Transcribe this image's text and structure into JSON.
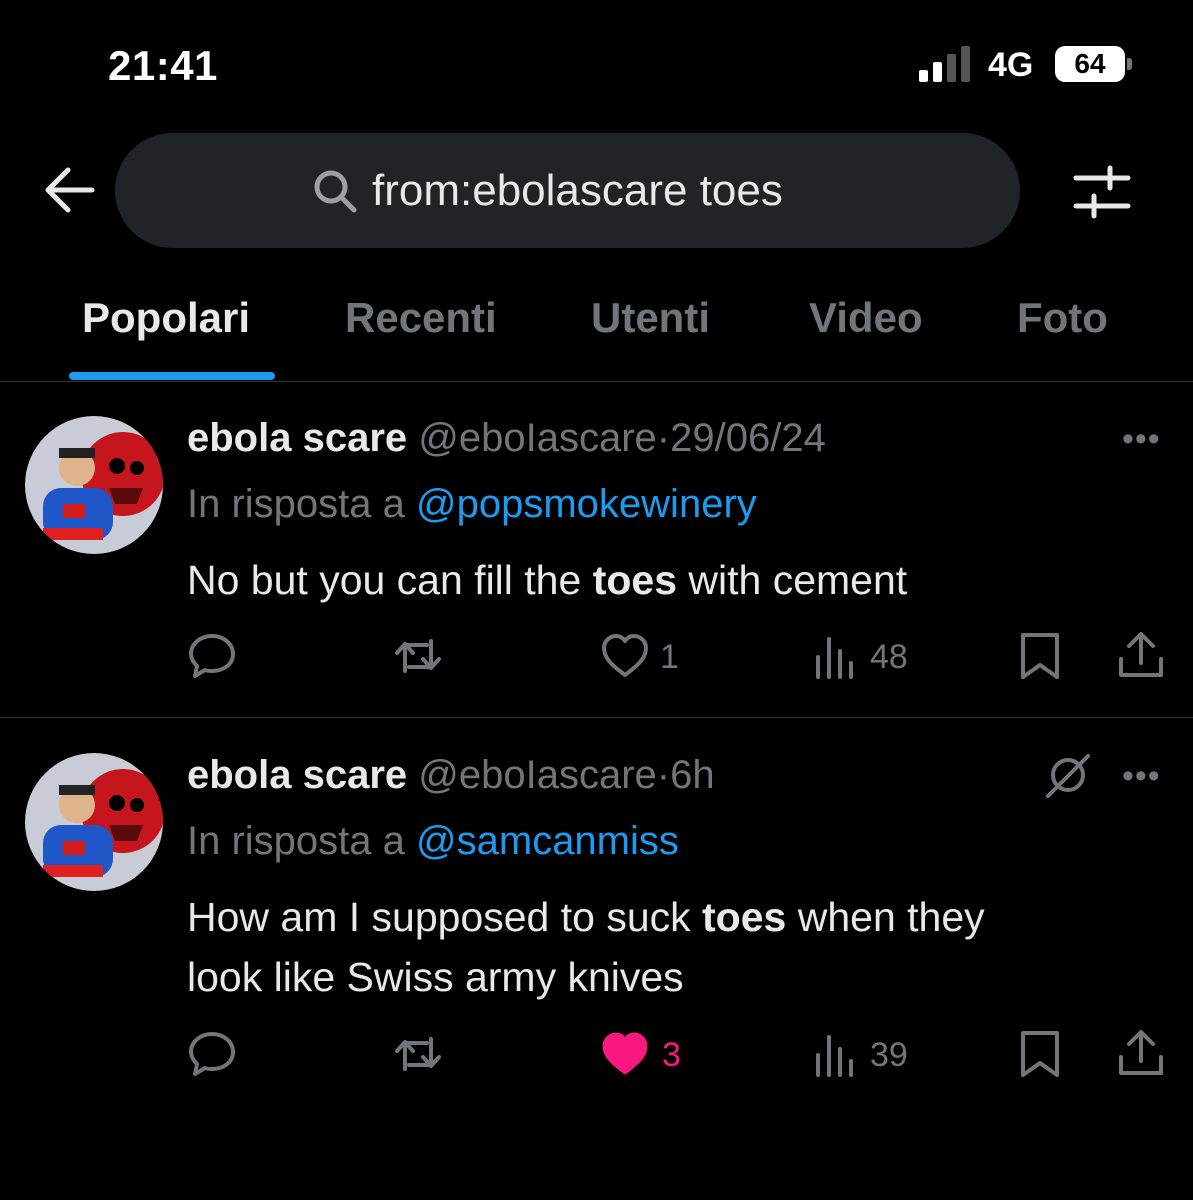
{
  "status_bar": {
    "time": "21:41",
    "network": "4G",
    "battery": "64"
  },
  "search": {
    "query": "from:ebolascare toes"
  },
  "tabs": [
    {
      "label": "Popolari",
      "active": true
    },
    {
      "label": "Recenti",
      "active": false
    },
    {
      "label": "Utenti",
      "active": false
    },
    {
      "label": "Video",
      "active": false
    },
    {
      "label": "Foto",
      "active": false
    }
  ],
  "tweets": [
    {
      "name": "ebola scare",
      "handle": "@eboIascare",
      "dot": "·",
      "date": "29/06/24",
      "reply_prefix": "In risposta a",
      "reply_to": "@popsmokewinery",
      "body": {
        "pre1": "No but you can fill the ",
        "bold1": "toes",
        "post1": " with cement",
        "line2": ""
      },
      "likes": "1",
      "views": "48",
      "liked": false
    },
    {
      "name": "ebola scare",
      "handle": "@eboIascare",
      "dot": "·",
      "date": "6h",
      "reply_prefix": "In risposta a",
      "reply_to": "@samcanmiss",
      "body": {
        "pre1": "How am I supposed to suck ",
        "bold1": "toes",
        "post1": " when they",
        "line2": "look like Swiss army knives"
      },
      "likes": "3",
      "views": "39",
      "liked": true
    }
  ],
  "colors": {
    "accent": "#1d9bf0",
    "like": "#f91880",
    "muted": "#71767b",
    "background": "#000000"
  },
  "icons": [
    "back-arrow-icon",
    "search-icon",
    "filter-icon",
    "more-icon",
    "grok-icon",
    "reply-icon",
    "retweet-icon",
    "heart-icon",
    "views-icon",
    "bookmark-icon",
    "share-icon"
  ]
}
